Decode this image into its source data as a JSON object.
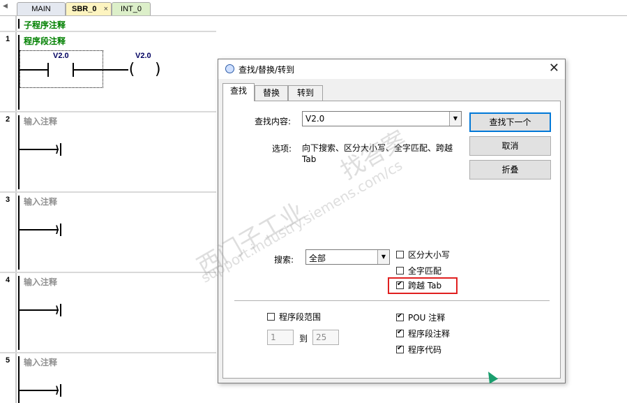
{
  "tabs": [
    {
      "label": "MAIN"
    },
    {
      "label": "SBR_0",
      "close": "×"
    },
    {
      "label": "INT_0"
    }
  ],
  "editor": {
    "program_comment": "子程序注释",
    "networks": [
      {
        "number": "1",
        "comment": "程序段注释",
        "contact_label": "V2.0",
        "coil_label": "V2.0"
      },
      {
        "number": "2",
        "comment": "输入注释"
      },
      {
        "number": "3",
        "comment": "输入注释"
      },
      {
        "number": "4",
        "comment": "输入注释"
      },
      {
        "number": "5",
        "comment": "输入注释"
      }
    ]
  },
  "dialog": {
    "title": "查找/替换/转到",
    "close_glyph": "✕",
    "tabs": [
      {
        "label": "查找",
        "active": true
      },
      {
        "label": "替换"
      },
      {
        "label": "转到"
      }
    ],
    "find_label": "查找内容:",
    "find_value": "V2.0",
    "options_label": "选项:",
    "options_text": "向下搜索、区分大小写、全字匹配、跨越 Tab",
    "buttons": {
      "find_next": "查找下一个",
      "cancel": "取消",
      "collapse": "折叠"
    },
    "search_label": "搜索:",
    "search_value": "全部",
    "match_case": {
      "label": "区分大小写",
      "checked": false
    },
    "whole_word": {
      "label": "全字匹配",
      "checked": false
    },
    "across_tabs": {
      "label": "跨越 Tab",
      "checked": true
    },
    "network_range": {
      "label": "程序段范围",
      "checked": false
    },
    "range_from": "1",
    "range_to_label": "到",
    "range_to": "25",
    "pou_comment": {
      "label": "POU 注释",
      "checked": true
    },
    "network_comment": {
      "label": "程序段注释",
      "checked": true
    },
    "program_code": {
      "label": "程序代码",
      "checked": true
    }
  },
  "watermark": {
    "line1": "西门子工业",
    "line2": "support.industry.siemens.com/cs",
    "line3": "找答案"
  },
  "colors": {
    "highlight": "#e02020",
    "default_button": "#0078d7",
    "comment_green": "#008000"
  }
}
